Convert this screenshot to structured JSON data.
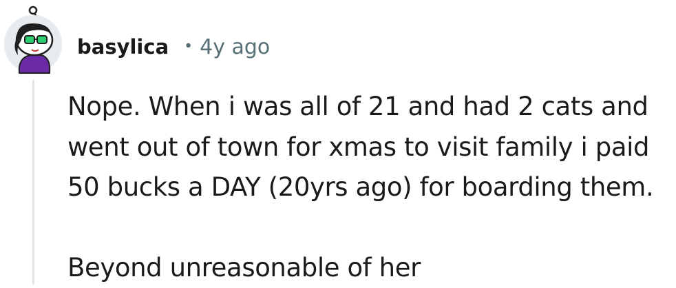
{
  "comment": {
    "author": "basylica",
    "separator": "•",
    "age": "4y ago",
    "paragraphs": [
      "Nope. When i was all of 21 and had 2 cats and went out of town for xmas to visit family i paid 50 bucks a DAY (20yrs ago) for boarding them.",
      "Beyond unreasonable of her"
    ],
    "avatar_icon": "snoo-avatar-icon"
  },
  "colors": {
    "text": "#1a1a1b",
    "meta": "#576f76",
    "thread_line": "#e2e4e6",
    "avatar_bg": "#e5ebee",
    "glasses": "#2ecc71",
    "shirt": "#6a2aa5",
    "hair": "#1f1f1f"
  }
}
